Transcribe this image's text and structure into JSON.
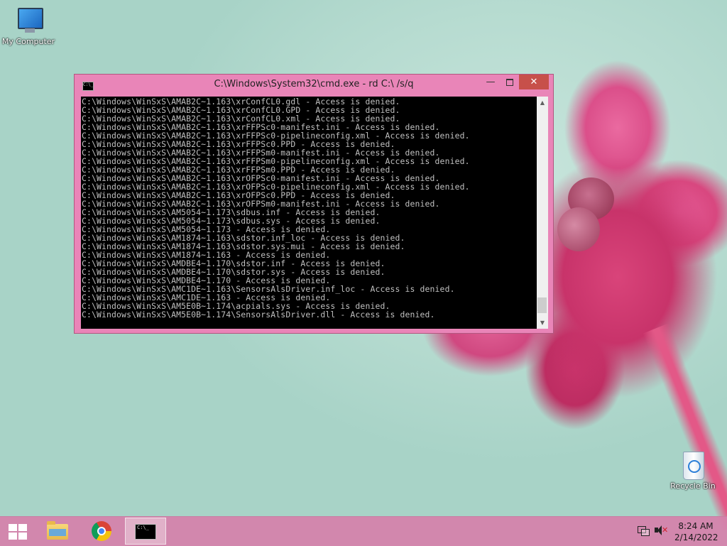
{
  "desktop": {
    "icons": [
      {
        "label": "My Computer"
      },
      {
        "label": "Recycle Bin"
      }
    ]
  },
  "cmd_window": {
    "title": "C:\\Windows\\System32\\cmd.exe - rd  C:\\ /s/q",
    "buttons": {
      "minimize": "—",
      "close": "✕"
    },
    "icon_text": "C:\\_",
    "lines": [
      "C:\\Windows\\WinSxS\\AMAB2C~1.163\\xrConfCL0.gdl - Access is denied.",
      "C:\\Windows\\WinSxS\\AMAB2C~1.163\\xrConfCL0.GPD - Access is denied.",
      "C:\\Windows\\WinSxS\\AMAB2C~1.163\\xrConfCL0.xml - Access is denied.",
      "C:\\Windows\\WinSxS\\AMAB2C~1.163\\xrFFPSc0-manifest.ini - Access is denied.",
      "C:\\Windows\\WinSxS\\AMAB2C~1.163\\xrFFPSc0-pipelineconfig.xml - Access is denied.",
      "C:\\Windows\\WinSxS\\AMAB2C~1.163\\xrFFPSc0.PPD - Access is denied.",
      "C:\\Windows\\WinSxS\\AMAB2C~1.163\\xrFFPSm0-manifest.ini - Access is denied.",
      "C:\\Windows\\WinSxS\\AMAB2C~1.163\\xrFFPSm0-pipelineconfig.xml - Access is denied.",
      "C:\\Windows\\WinSxS\\AMAB2C~1.163\\xrFFPSm0.PPD - Access is denied.",
      "C:\\Windows\\WinSxS\\AMAB2C~1.163\\xrOFPSc0-manifest.ini - Access is denied.",
      "C:\\Windows\\WinSxS\\AMAB2C~1.163\\xrOFPSc0-pipelineconfig.xml - Access is denied.",
      "C:\\Windows\\WinSxS\\AMAB2C~1.163\\xrOFPSc0.PPD - Access is denied.",
      "C:\\Windows\\WinSxS\\AMAB2C~1.163\\xrOFPSm0-manifest.ini - Access is denied.",
      "C:\\Windows\\WinSxS\\AM5054~1.173\\sdbus.inf - Access is denied.",
      "C:\\Windows\\WinSxS\\AM5054~1.173\\sdbus.sys - Access is denied.",
      "C:\\Windows\\WinSxS\\AM5054~1.173 - Access is denied.",
      "C:\\Windows\\WinSxS\\AM1874~1.163\\sdstor.inf_loc - Access is denied.",
      "C:\\Windows\\WinSxS\\AM1874~1.163\\sdstor.sys.mui - Access is denied.",
      "C:\\Windows\\WinSxS\\AM1874~1.163 - Access is denied.",
      "C:\\Windows\\WinSxS\\AMDBE4~1.170\\sdstor.inf - Access is denied.",
      "C:\\Windows\\WinSxS\\AMDBE4~1.170\\sdstor.sys - Access is denied.",
      "C:\\Windows\\WinSxS\\AMDBE4~1.170 - Access is denied.",
      "C:\\Windows\\WinSxS\\AMC1DE~1.163\\SensorsAlsDriver.inf_loc - Access is denied.",
      "C:\\Windows\\WinSxS\\AMC1DE~1.163 - Access is denied.",
      "C:\\Windows\\WinSxS\\AM5E0B~1.174\\acpials.sys - Access is denied.",
      "C:\\Windows\\WinSxS\\AM5E0B~1.174\\SensorsAlsDriver.dll - Access is denied."
    ],
    "scrollbar": {
      "up": "▲",
      "down": "▼"
    }
  },
  "taskbar": {
    "pinned": [
      {
        "name": "File Explorer"
      },
      {
        "name": "Google Chrome"
      },
      {
        "name": "Command Prompt",
        "active": true,
        "icon_text": "C:\\_"
      }
    ],
    "tray": {
      "mute_mark": "✕",
      "time": "8:24 AM",
      "date": "2/14/2022"
    }
  }
}
